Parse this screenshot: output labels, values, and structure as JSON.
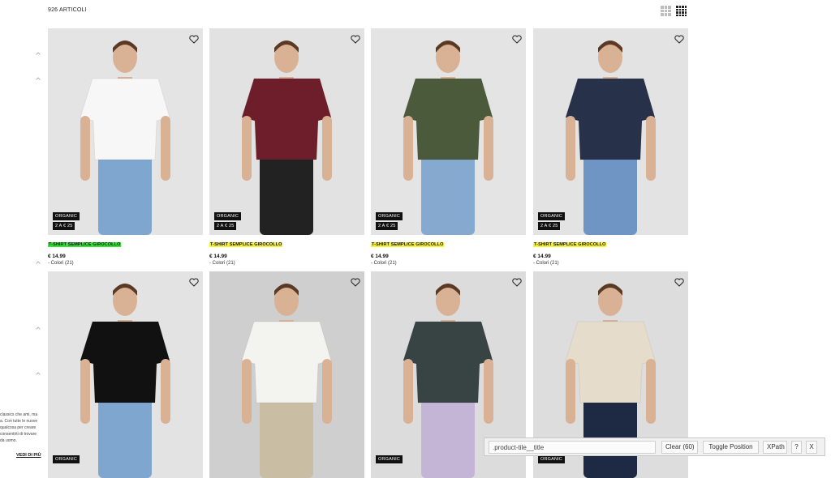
{
  "header": {
    "article_count": "926 ARTICOLI"
  },
  "view_toggle": [
    "grid-large-icon",
    "grid-small-icon"
  ],
  "products": [
    {
      "title": "T-SHIRT SEMPLICE GIROCOLLO",
      "price": "€ 14.99",
      "colors": "- Colori (21)",
      "badges": [
        "ORGANIC",
        "2 A € 25"
      ],
      "highlight": "#34e23a",
      "bg": "#e4e4e4",
      "shirt": "#f7f7f7",
      "pants": "#7fa6cf"
    },
    {
      "title": "T-SHIRT SEMPLICE GIROCOLLO",
      "price": "€ 14.99",
      "colors": "- Colori (21)",
      "badges": [
        "ORGANIC",
        "2 A € 25"
      ],
      "highlight": "#f5f13a",
      "bg": "#e2e2e2",
      "shirt": "#6e1e2b",
      "pants": "#222222"
    },
    {
      "title": "T-SHIRT SEMPLICE GIROCOLLO",
      "price": "€ 14.99",
      "colors": "- Colori (21)",
      "badges": [
        "ORGANIC",
        "2 A € 25"
      ],
      "highlight": "#f5f13a",
      "bg": "#e4e4e4",
      "shirt": "#4a5a3a",
      "pants": "#86a9cf"
    },
    {
      "title": "T-SHIRT SEMPLICE GIROCOLLO",
      "price": "€ 14.99",
      "colors": "- Colori (21)",
      "badges": [
        "ORGANIC",
        "2 A € 25"
      ],
      "highlight": "#f5f13a",
      "bg": "#e3e3e3",
      "shirt": "#27314a",
      "pants": "#6e95c4"
    },
    {
      "title": "",
      "price": "",
      "colors": "",
      "badges": [
        "ORGANIC"
      ],
      "highlight": "",
      "bg": "#e3e3e3",
      "shirt": "#111111",
      "pants": "#7fa6cf"
    },
    {
      "title": "",
      "price": "",
      "colors": "",
      "badges": [],
      "highlight": "",
      "bg": "#cfcfcf",
      "shirt": "#f3f3f0",
      "pants": "#c9bda4"
    },
    {
      "title": "",
      "price": "",
      "colors": "",
      "badges": [
        "ORGANIC"
      ],
      "highlight": "",
      "bg": "#dcdcdc",
      "shirt": "#384444",
      "pants": "#c4b5d6"
    },
    {
      "title": "",
      "price": "",
      "colors": "",
      "badges": [
        "ORGANIC"
      ],
      "highlight": "",
      "bg": "#dddddd",
      "shirt": "#e6dccb",
      "pants": "#1e2a44"
    }
  ],
  "side_text": [
    "classics che ami, ma",
    "a. Con tutte le nuove",
    "qualcosa per creare",
    "consentirti di trovare",
    "da uomo."
  ],
  "see_more": "VEDI DI PIÙ",
  "inspector": {
    "selector_value": ".product-tile__title",
    "clear_label": "Clear (60)",
    "toggle_label": "Toggle Position",
    "xpath_label": "XPath",
    "help_label": "?",
    "close_label": "X"
  }
}
